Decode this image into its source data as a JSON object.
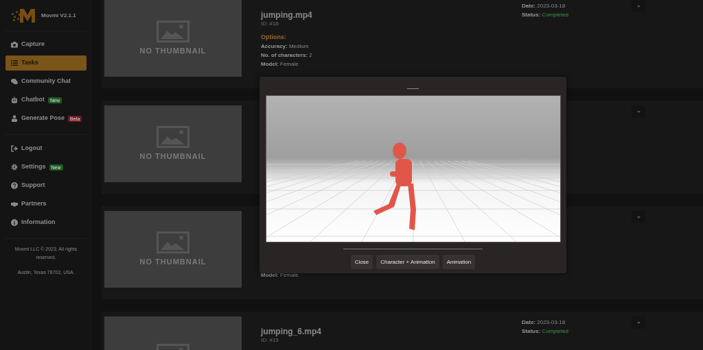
{
  "sidebar": {
    "app_name": "Movmi V2.1.1",
    "nav_items": [
      {
        "label": "Capture",
        "selected": false
      },
      {
        "label": "Tasks",
        "selected": true
      },
      {
        "label": "Community Chat",
        "selected": false
      },
      {
        "label": "Chatbot",
        "selected": false,
        "badge": {
          "text": "New",
          "color": "#1f5a24"
        }
      },
      {
        "label": "Generate Pose",
        "selected": false,
        "badge": {
          "text": "Beta",
          "color": "#6e1c24"
        }
      }
    ],
    "account_items": [
      {
        "label": "Logout",
        "selected": false
      },
      {
        "label": "Settings",
        "selected": false,
        "badge": {
          "text": "New",
          "color": "#1f5a24"
        }
      },
      {
        "label": "Support",
        "selected": false
      },
      {
        "label": "Partners",
        "selected": false
      },
      {
        "label": "Information",
        "selected": false
      }
    ],
    "footer": [
      "Movmi LLC © 2023. All rights reserved.",
      "Austin, Texas 78702, USA."
    ]
  },
  "tasks": [
    {
      "thumbnail": "NO THUMBNAIL",
      "title": "jumping.mp4",
      "id": "ID: #18",
      "options_heading": "Options:",
      "details": [
        {
          "label": "Accuracy:",
          "value": "Medium"
        },
        {
          "label": "No. of characters:",
          "value": "2"
        },
        {
          "label": "Model:",
          "value": "Female"
        }
      ],
      "date_label": "Date:",
      "date": "2023-03-18",
      "status_label": "Status:",
      "status": "Completed"
    },
    {
      "thumbnail": "NO THUMBNAIL"
    },
    {
      "thumbnail": "NO THUMBNAIL",
      "details": [
        {
          "label": "Model:",
          "value": "Female"
        }
      ]
    },
    {
      "title": "jumping_6.mp4",
      "id": "ID: #15",
      "date_label": "Date:",
      "date": "2023-03-18",
      "status_label": "Status:",
      "status": "Completed"
    }
  ],
  "modal": {
    "viewer": {
      "kind": "picture"
    },
    "buttons": [
      "Close",
      "Character + Animation",
      "Animation"
    ]
  }
}
